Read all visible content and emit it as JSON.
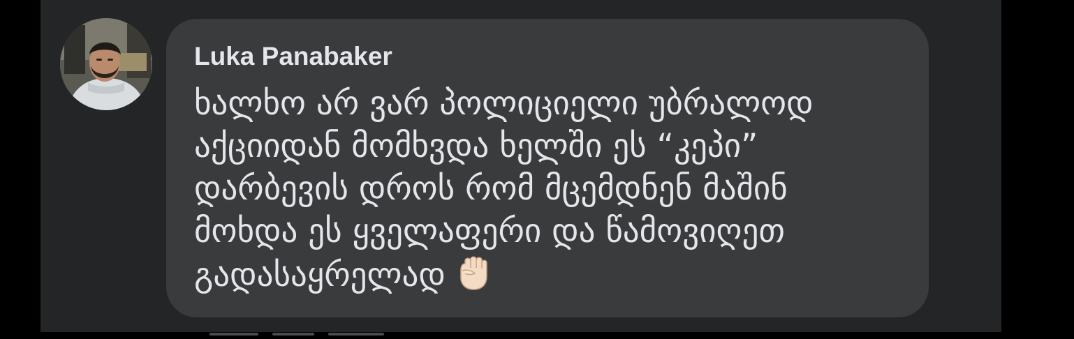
{
  "comment": {
    "author": "Luka Panabaker",
    "lines": [
      "ხალხო არ ვარ პოლიციელი უბრალოდ",
      "აქციიდან მომხვდა ხელში ეს “კეპი”",
      "დარბევის დროს რომ მცემდნენ მაშინ",
      "მოხდა ეს ყველაფერი და წამოვიღეთ",
      "გადასაყრელად"
    ],
    "emoji": "raised-fist-icon"
  },
  "colors": {
    "background": "#000000",
    "panel": "#242526",
    "bubble": "#3a3b3c",
    "text": "#e4e6eb"
  }
}
